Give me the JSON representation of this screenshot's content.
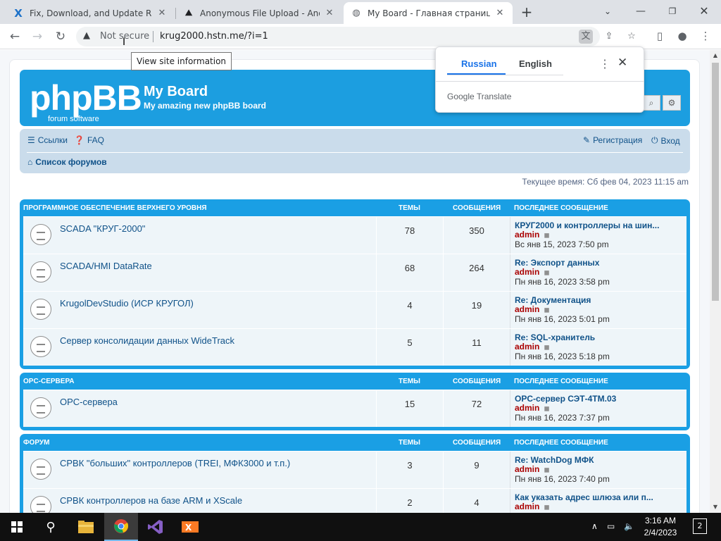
{
  "browser": {
    "tabs": [
      {
        "title": "Fix, Download, and Update Rsm",
        "close": "✕"
      },
      {
        "title": "Anonymous File Upload - AnonFi",
        "close": "✕"
      },
      {
        "title": "My Board - Главная страница",
        "close": "✕"
      }
    ],
    "new_tab": "+",
    "address": {
      "security": "Not secure",
      "url": "krug2000.hstn.me/?i=1"
    },
    "tooltip": "View site information"
  },
  "translate_popup": {
    "tab_source": "Russian",
    "tab_target": "English",
    "brand": "Google",
    "brand_suffix": "Translate"
  },
  "board": {
    "logo_text": "phpBB",
    "logo_sub": "forum  software",
    "site_name": "My Board",
    "site_desc": "My amazing new phpBB board",
    "nav": {
      "links": "Ссылки",
      "faq": "FAQ",
      "register": "Регистрация",
      "login": "Вход",
      "crumb": "Список форумов"
    },
    "current_time": "Текущее время: Сб фев 04, 2023 11:15 am",
    "col_topics": "ТЕМЫ",
    "col_posts": "СООБЩЕНИЯ",
    "col_last": "ПОСЛЕДНЕЕ СООБЩЕНИЕ",
    "categories": [
      {
        "name": "ПРОГРАММНОЕ ОБЕСПЕЧЕНИЕ ВЕРХНЕГО УРОВНЯ",
        "forums": [
          {
            "name": "SCADA \"КРУГ-2000\"",
            "topics": "78",
            "posts": "350",
            "last_title": "КРУГ2000 и контроллеры на шин...",
            "last_author": "admin",
            "last_date": "Вс янв 15, 2023 7:50 pm"
          },
          {
            "name": "SCADA/HMI DataRate",
            "topics": "68",
            "posts": "264",
            "last_title": "Re: Экспорт данных",
            "last_author": "admin",
            "last_date": "Пн янв 16, 2023 3:58 pm"
          },
          {
            "name": "KrugolDevStudio (ИСР КРУГОЛ)",
            "topics": "4",
            "posts": "19",
            "last_title": "Re: Документация",
            "last_author": "admin",
            "last_date": "Пн янв 16, 2023 5:01 pm"
          },
          {
            "name": "Сервер консолидации данных WideTrack",
            "topics": "5",
            "posts": "11",
            "last_title": "Re: SQL-хранитель",
            "last_author": "admin",
            "last_date": "Пн янв 16, 2023 5:18 pm"
          }
        ]
      },
      {
        "name": "OPC-СЕРВЕРА",
        "forums": [
          {
            "name": "OPC-сервера",
            "topics": "15",
            "posts": "72",
            "last_title": "OPC-сервер СЭТ-4ТМ.03",
            "last_author": "admin",
            "last_date": "Пн янв 16, 2023 7:37 pm"
          }
        ]
      },
      {
        "name": "ФОРУМ",
        "forums": [
          {
            "name": "СРВК \"больших\" контроллеров (TREI, МФК3000 и т.п.)",
            "topics": "3",
            "posts": "9",
            "last_title": "Re: WatchDog МФК",
            "last_author": "admin",
            "last_date": "Пн янв 16, 2023 7:40 pm"
          },
          {
            "name": "СРВК контроллеров на базе ARM и XScale",
            "topics": "2",
            "posts": "4",
            "last_title": "Как указать адрес шлюза или п...",
            "last_author": "admin",
            "last_date": ""
          }
        ]
      }
    ]
  },
  "taskbar": {
    "time": "3:16 AM",
    "date": "2/4/2023",
    "notifications": "2"
  },
  "colors": {
    "phpbb_blue": "#1a9fe4",
    "link_blue": "#105289",
    "author_red": "#aa0000"
  }
}
